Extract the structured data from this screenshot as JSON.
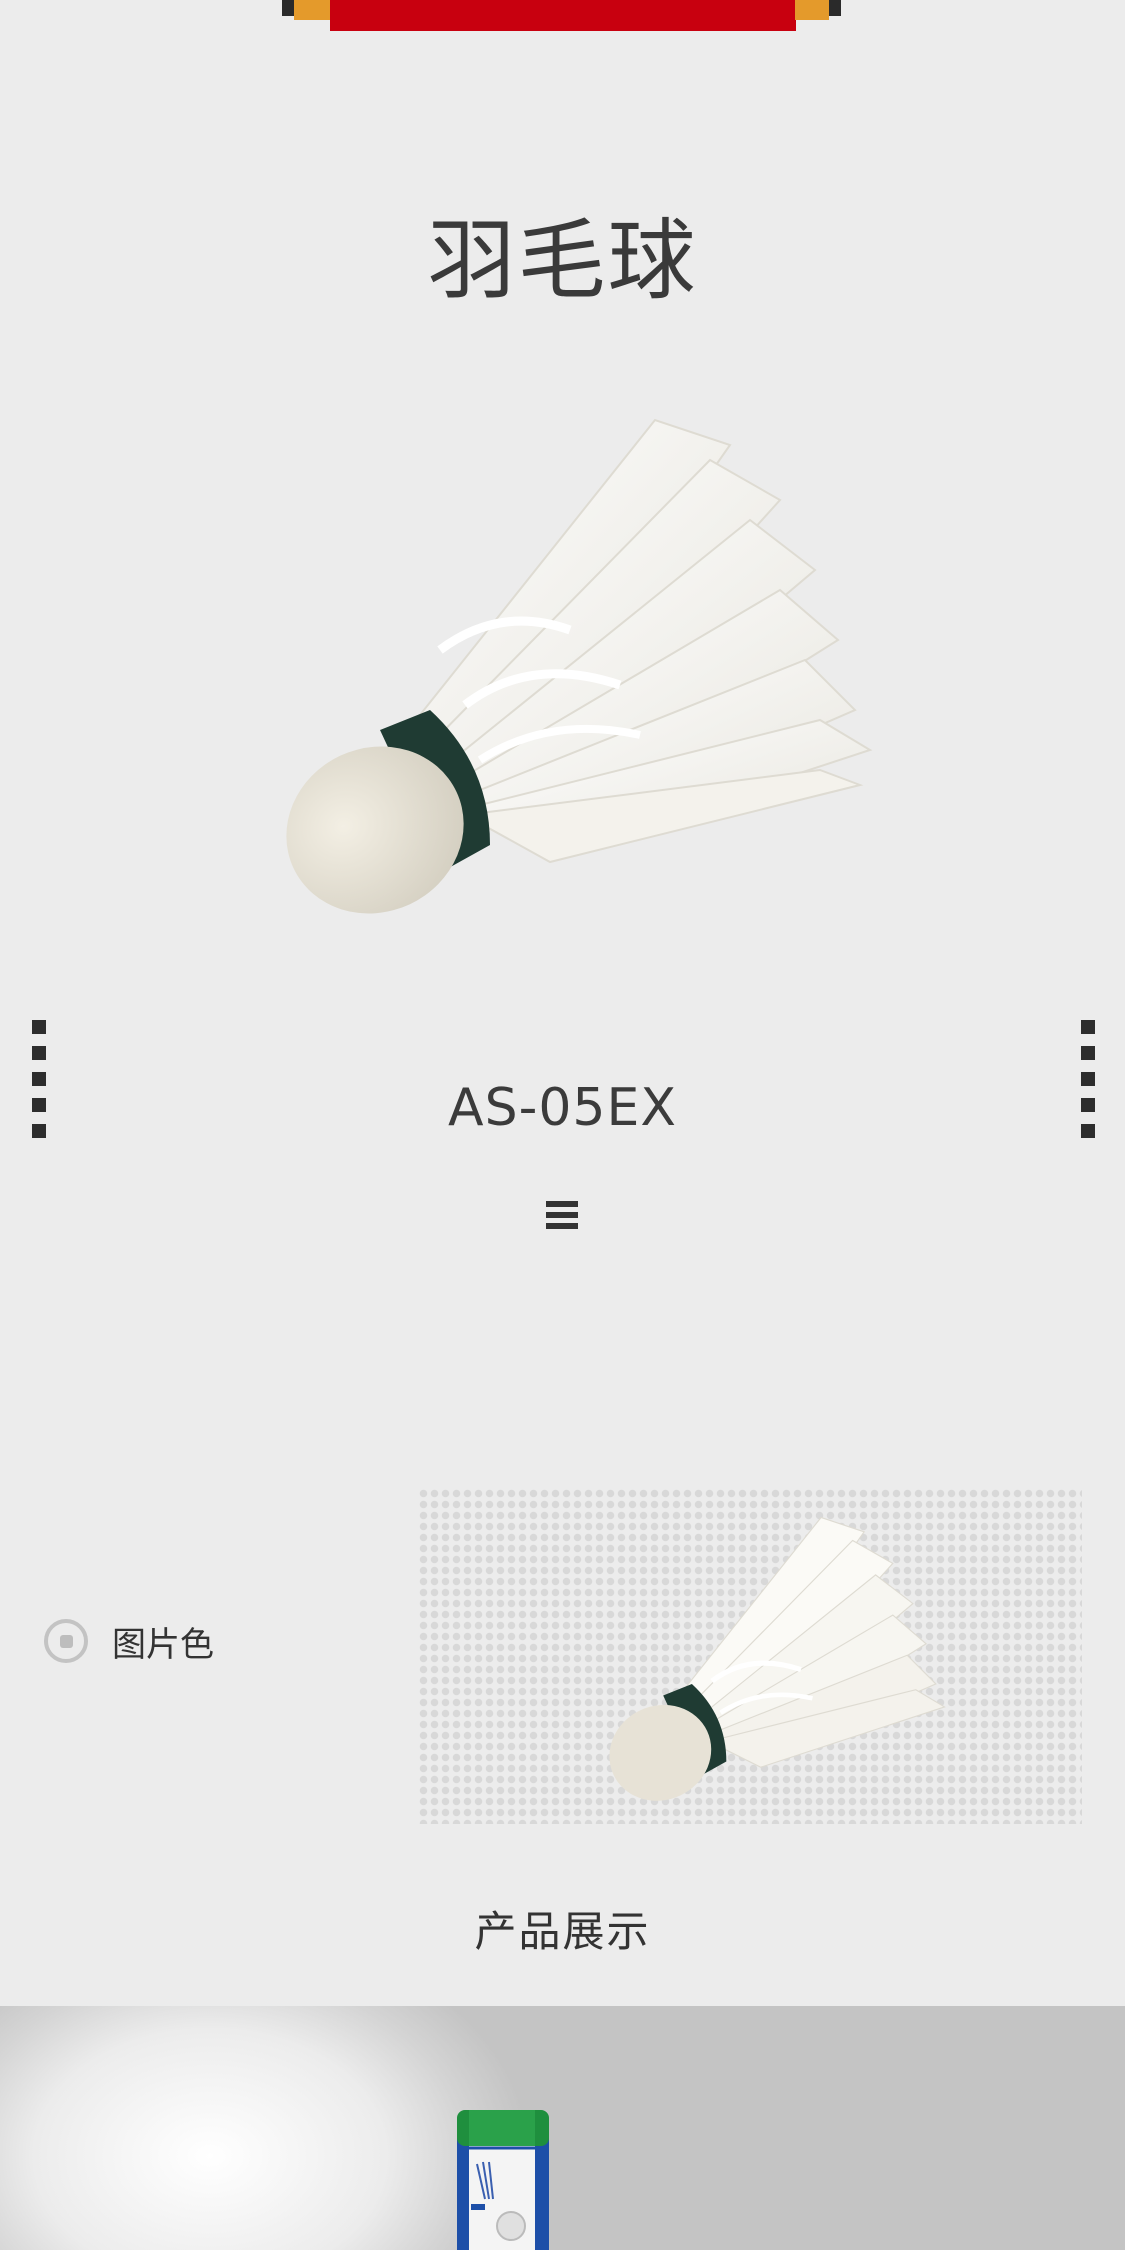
{
  "banner": {
    "colors": {
      "red": "#c8000f",
      "orange": "#e49a2b",
      "dark": "#2a2a2a"
    }
  },
  "page": {
    "title": "羽毛球"
  },
  "hero": {
    "image_icon": "shuttlecock-image"
  },
  "carousel": {
    "prev_icon": "nav-dots-left-icon",
    "next_icon": "nav-dots-right-icon"
  },
  "product": {
    "model": "AS-05EX"
  },
  "menu": {
    "icon": "menu-icon"
  },
  "options": {
    "color_label": "图片色",
    "selected": true
  },
  "showcase": {
    "section_title": "产品展示",
    "image_icon": "shuttlecock-tube-image"
  },
  "colors": {
    "background": "#ececec",
    "text": "#333333",
    "tube_green": "#1f8f3e",
    "tube_blue": "#1d4fa8",
    "cork_band": "#1f3b33"
  }
}
